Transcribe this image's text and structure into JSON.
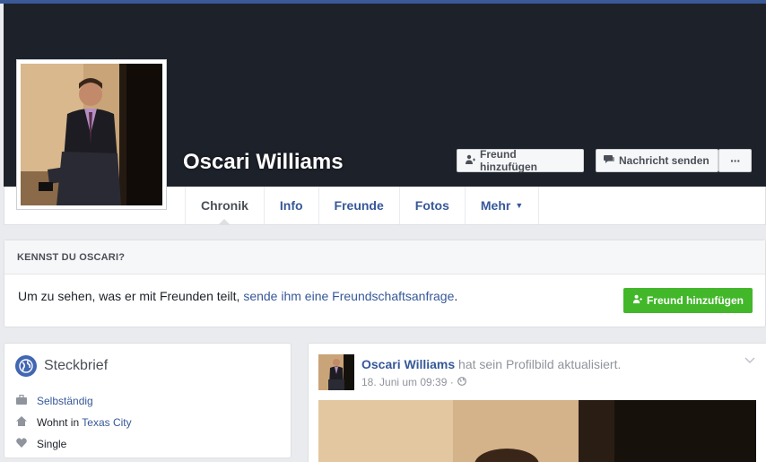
{
  "profile": {
    "name": "Oscari Williams",
    "add_friend_label": "Freund hinzufügen",
    "message_label": "Nachricht senden",
    "more_label": "···"
  },
  "nav": {
    "tabs": [
      {
        "label": "Chronik",
        "active": true
      },
      {
        "label": "Info"
      },
      {
        "label": "Freunde"
      },
      {
        "label": "Fotos"
      },
      {
        "label": "Mehr"
      }
    ]
  },
  "know": {
    "heading": "KENNST DU OSCARI?",
    "text_before": "Um zu sehen, was er mit Freunden teilt, ",
    "link": "sende ihm eine Freundschaftsanfrage",
    "text_after": ".",
    "button": "Freund hinzufügen"
  },
  "intro": {
    "title": "Steckbrief",
    "rows": [
      {
        "icon": "briefcase-icon",
        "prefix": "",
        "link": "Selbständig"
      },
      {
        "icon": "home-icon",
        "prefix": "Wohnt in ",
        "link": "Texas City"
      },
      {
        "icon": "heart-icon",
        "prefix": "Single",
        "link": ""
      }
    ]
  },
  "post": {
    "author": "Oscari Williams",
    "action": " hat sein Profilbild aktualisiert.",
    "time": "18. Juni um 09:39 ·"
  },
  "colors": {
    "brand_blue": "#3b5998",
    "link": "#365899",
    "green": "#42b72a",
    "cover": "#1d2129"
  }
}
